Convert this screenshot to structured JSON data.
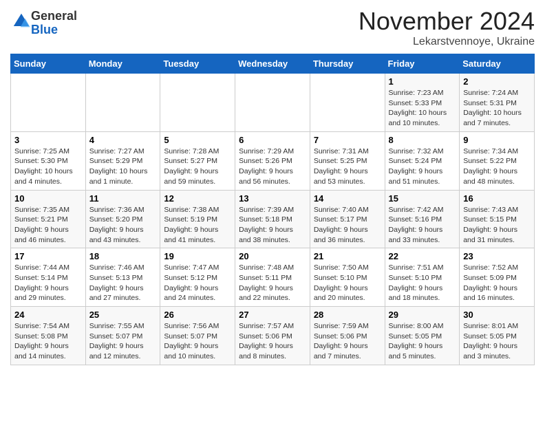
{
  "logo": {
    "general": "General",
    "blue": "Blue"
  },
  "header": {
    "month": "November 2024",
    "location": "Lekarstvennoye, Ukraine"
  },
  "weekdays": [
    "Sunday",
    "Monday",
    "Tuesday",
    "Wednesday",
    "Thursday",
    "Friday",
    "Saturday"
  ],
  "weeks": [
    [
      {
        "day": "",
        "info": ""
      },
      {
        "day": "",
        "info": ""
      },
      {
        "day": "",
        "info": ""
      },
      {
        "day": "",
        "info": ""
      },
      {
        "day": "",
        "info": ""
      },
      {
        "day": "1",
        "info": "Sunrise: 7:23 AM\nSunset: 5:33 PM\nDaylight: 10 hours and 10 minutes."
      },
      {
        "day": "2",
        "info": "Sunrise: 7:24 AM\nSunset: 5:31 PM\nDaylight: 10 hours and 7 minutes."
      }
    ],
    [
      {
        "day": "3",
        "info": "Sunrise: 7:25 AM\nSunset: 5:30 PM\nDaylight: 10 hours and 4 minutes."
      },
      {
        "day": "4",
        "info": "Sunrise: 7:27 AM\nSunset: 5:29 PM\nDaylight: 10 hours and 1 minute."
      },
      {
        "day": "5",
        "info": "Sunrise: 7:28 AM\nSunset: 5:27 PM\nDaylight: 9 hours and 59 minutes."
      },
      {
        "day": "6",
        "info": "Sunrise: 7:29 AM\nSunset: 5:26 PM\nDaylight: 9 hours and 56 minutes."
      },
      {
        "day": "7",
        "info": "Sunrise: 7:31 AM\nSunset: 5:25 PM\nDaylight: 9 hours and 53 minutes."
      },
      {
        "day": "8",
        "info": "Sunrise: 7:32 AM\nSunset: 5:24 PM\nDaylight: 9 hours and 51 minutes."
      },
      {
        "day": "9",
        "info": "Sunrise: 7:34 AM\nSunset: 5:22 PM\nDaylight: 9 hours and 48 minutes."
      }
    ],
    [
      {
        "day": "10",
        "info": "Sunrise: 7:35 AM\nSunset: 5:21 PM\nDaylight: 9 hours and 46 minutes."
      },
      {
        "day": "11",
        "info": "Sunrise: 7:36 AM\nSunset: 5:20 PM\nDaylight: 9 hours and 43 minutes."
      },
      {
        "day": "12",
        "info": "Sunrise: 7:38 AM\nSunset: 5:19 PM\nDaylight: 9 hours and 41 minutes."
      },
      {
        "day": "13",
        "info": "Sunrise: 7:39 AM\nSunset: 5:18 PM\nDaylight: 9 hours and 38 minutes."
      },
      {
        "day": "14",
        "info": "Sunrise: 7:40 AM\nSunset: 5:17 PM\nDaylight: 9 hours and 36 minutes."
      },
      {
        "day": "15",
        "info": "Sunrise: 7:42 AM\nSunset: 5:16 PM\nDaylight: 9 hours and 33 minutes."
      },
      {
        "day": "16",
        "info": "Sunrise: 7:43 AM\nSunset: 5:15 PM\nDaylight: 9 hours and 31 minutes."
      }
    ],
    [
      {
        "day": "17",
        "info": "Sunrise: 7:44 AM\nSunset: 5:14 PM\nDaylight: 9 hours and 29 minutes."
      },
      {
        "day": "18",
        "info": "Sunrise: 7:46 AM\nSunset: 5:13 PM\nDaylight: 9 hours and 27 minutes."
      },
      {
        "day": "19",
        "info": "Sunrise: 7:47 AM\nSunset: 5:12 PM\nDaylight: 9 hours and 24 minutes."
      },
      {
        "day": "20",
        "info": "Sunrise: 7:48 AM\nSunset: 5:11 PM\nDaylight: 9 hours and 22 minutes."
      },
      {
        "day": "21",
        "info": "Sunrise: 7:50 AM\nSunset: 5:10 PM\nDaylight: 9 hours and 20 minutes."
      },
      {
        "day": "22",
        "info": "Sunrise: 7:51 AM\nSunset: 5:10 PM\nDaylight: 9 hours and 18 minutes."
      },
      {
        "day": "23",
        "info": "Sunrise: 7:52 AM\nSunset: 5:09 PM\nDaylight: 9 hours and 16 minutes."
      }
    ],
    [
      {
        "day": "24",
        "info": "Sunrise: 7:54 AM\nSunset: 5:08 PM\nDaylight: 9 hours and 14 minutes."
      },
      {
        "day": "25",
        "info": "Sunrise: 7:55 AM\nSunset: 5:07 PM\nDaylight: 9 hours and 12 minutes."
      },
      {
        "day": "26",
        "info": "Sunrise: 7:56 AM\nSunset: 5:07 PM\nDaylight: 9 hours and 10 minutes."
      },
      {
        "day": "27",
        "info": "Sunrise: 7:57 AM\nSunset: 5:06 PM\nDaylight: 9 hours and 8 minutes."
      },
      {
        "day": "28",
        "info": "Sunrise: 7:59 AM\nSunset: 5:06 PM\nDaylight: 9 hours and 7 minutes."
      },
      {
        "day": "29",
        "info": "Sunrise: 8:00 AM\nSunset: 5:05 PM\nDaylight: 9 hours and 5 minutes."
      },
      {
        "day": "30",
        "info": "Sunrise: 8:01 AM\nSunset: 5:05 PM\nDaylight: 9 hours and 3 minutes."
      }
    ]
  ]
}
